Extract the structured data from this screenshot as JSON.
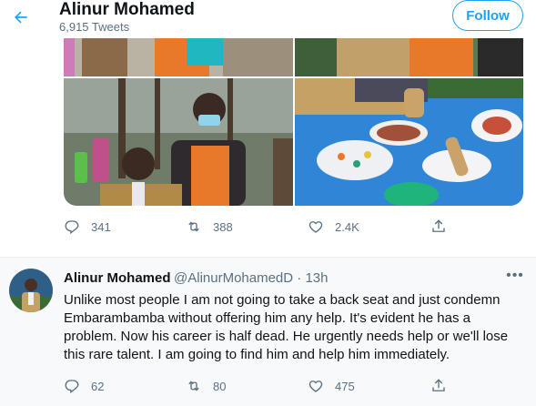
{
  "header": {
    "title": "Alinur Mohamed",
    "tweet_count": "6,915 Tweets",
    "follow_label": "Follow"
  },
  "tweet1": {
    "actions": {
      "replies": "341",
      "retweets": "388",
      "likes": "2.4K"
    }
  },
  "tweet2": {
    "name": "Alinur Mohamed",
    "handle": "@AlinurMohamedD",
    "separator": "·",
    "time": "13h",
    "text": "Unlike most people I am not going to take a back seat and just condemn Embarambamba without offering him any help. It's evident he has a problem. Now his career is half dead. He urgently needs help or we'll lose this rare talent. I am going to find him and help him immediately.",
    "actions": {
      "replies": "62",
      "retweets": "80",
      "likes": "475"
    }
  },
  "colors": {
    "accent": "#1da1f2",
    "secondary_text": "#5b7083",
    "apron_orange": "#e8782a",
    "table_blue": "#2f86d6"
  },
  "icons": [
    "back-arrow-icon",
    "reply-icon",
    "retweet-icon",
    "like-icon",
    "share-icon",
    "more-icon"
  ]
}
